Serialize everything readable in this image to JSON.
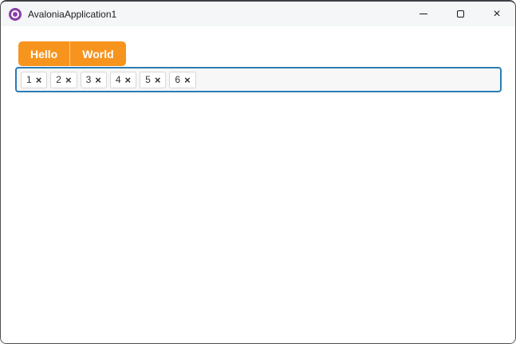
{
  "window": {
    "title": "AvaloniaApplication1",
    "close_glyph": "×",
    "icons": {
      "app": "avalonia-logo-icon",
      "minimize": "minimize-icon",
      "maximize": "maximize-icon",
      "close": "close-icon"
    }
  },
  "colors": {
    "accent_orange": "#F7941E",
    "focus_border_blue": "#2B7CB4",
    "logo_purple": "#8A3FA6",
    "titlebar_bg": "#F4F6F8",
    "tagbox_bg": "#F7F7F7",
    "chip_bg": "#FFFFFF"
  },
  "split_button": {
    "buttons": [
      {
        "label": "Hello"
      },
      {
        "label": "World"
      }
    ]
  },
  "tag_box": {
    "tags": [
      "1",
      "2",
      "3",
      "4",
      "5",
      "6"
    ],
    "remove_glyph": "×",
    "remove_icon": "x-icon"
  }
}
